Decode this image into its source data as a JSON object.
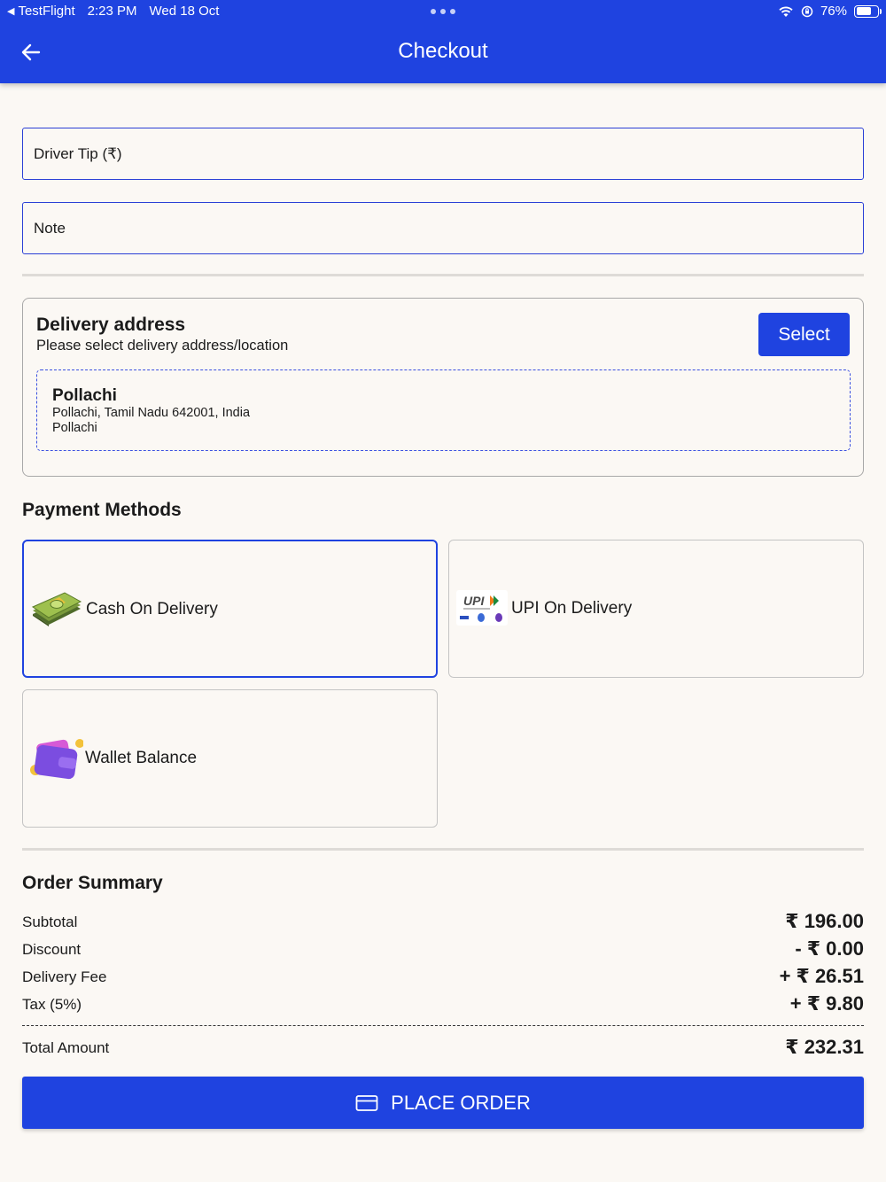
{
  "status_bar": {
    "app": "TestFlight",
    "time": "2:23 PM",
    "date": "Wed 18 Oct",
    "battery": "76%",
    "battery_level": 0.76
  },
  "header": {
    "title": "Checkout"
  },
  "form": {
    "driver_tip_placeholder": "Driver Tip (₹)",
    "note_placeholder": "Note"
  },
  "delivery": {
    "title": "Delivery address",
    "subtitle": "Please select delivery address/location",
    "select_label": "Select",
    "address": {
      "name": "Pollachi",
      "line1": "Pollachi, Tamil Nadu 642001, India",
      "line2": "Pollachi"
    }
  },
  "payment": {
    "title": "Payment Methods",
    "methods": [
      {
        "label": "Cash On Delivery",
        "icon": "cash-icon",
        "selected": true
      },
      {
        "label": "UPI On Delivery",
        "icon": "upi-icon",
        "selected": false
      },
      {
        "label": "Wallet Balance",
        "icon": "wallet-icon",
        "selected": false
      }
    ]
  },
  "summary": {
    "title": "Order Summary",
    "rows": [
      {
        "label": "Subtotal",
        "value": "₹ 196.00"
      },
      {
        "label": "Discount",
        "value": "- ₹ 0.00"
      },
      {
        "label": "Delivery Fee",
        "value": "+ ₹ 26.51"
      },
      {
        "label": "Tax (5%)",
        "value": "+ ₹ 9.80"
      }
    ],
    "total_label": "Total Amount",
    "total_value": "₹ 232.31"
  },
  "place_order_label": "PLACE ORDER",
  "colors": {
    "primary": "#1f43e0",
    "background": "#fbf8f4"
  }
}
